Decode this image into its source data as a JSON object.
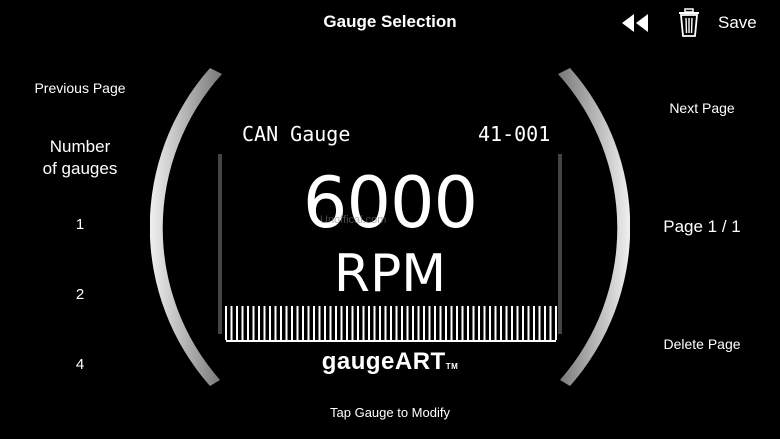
{
  "header": {
    "title": "Gauge Selection",
    "save_label": "Save",
    "rewind_icon": "rewind-icon",
    "trash_icon": "trash-icon"
  },
  "left_panel": {
    "previous_page": "Previous Page",
    "number_label_line1": "Number",
    "number_label_line2": "of gauges",
    "options": [
      "1",
      "2",
      "4"
    ]
  },
  "right_panel": {
    "next_page": "Next Page",
    "page_indicator": "Page 1 / 1",
    "delete_page": "Delete Page"
  },
  "gauge": {
    "name": "CAN Gauge",
    "code": "41-001",
    "value": "6000",
    "unit": "RPM",
    "logo": "gaugeART",
    "logo_tm": "TM",
    "watermark": "Unoffical.com"
  },
  "footer": {
    "hint": "Tap Gauge to Modify"
  },
  "colors": {
    "background": "#000000",
    "text": "#ffffff",
    "bezel": "#d9d9d9"
  }
}
